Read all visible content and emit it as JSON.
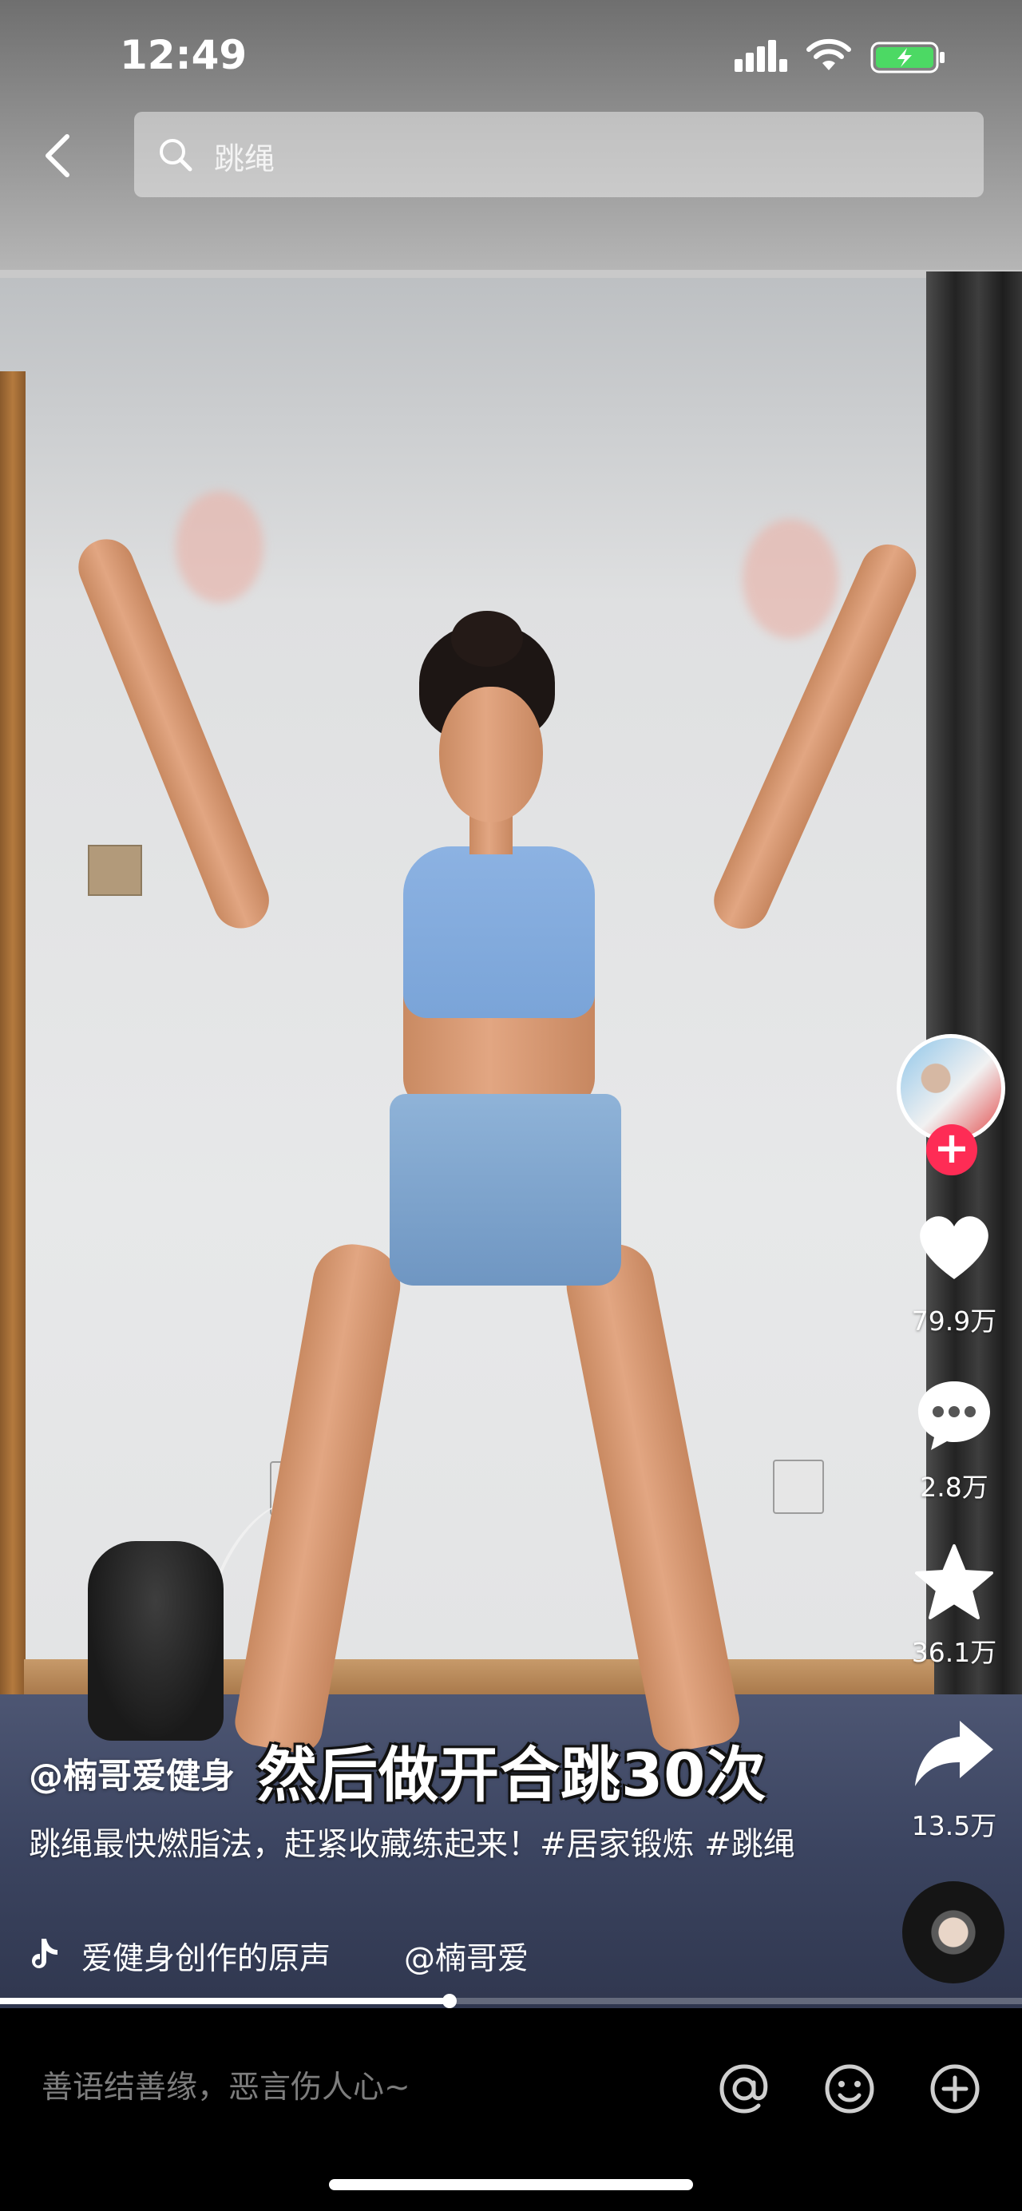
{
  "status_bar": {
    "time": "12:49"
  },
  "search": {
    "query": "跳绳"
  },
  "video": {
    "subtitle_overlay": "然后做开合跳30次",
    "author": "@楠哥爱健身",
    "description": "跳绳最快燃脂法，赶紧收藏练起来！#居家锻炼 #跳绳",
    "music_title": "爱健身创作的原声",
    "music_owner": "@楠哥爱",
    "progress": 0.44
  },
  "actions": {
    "likes": "79.9万",
    "comments": "2.8万",
    "favorites": "36.1万",
    "shares": "13.5万"
  },
  "comment_bar": {
    "placeholder": "善语结善缘，恶言伤人心~"
  },
  "icons": [
    "back-icon",
    "search-icon",
    "heart-icon",
    "comment-icon",
    "star-icon",
    "share-icon",
    "music-note-icon",
    "at-icon",
    "emoji-icon",
    "plus-icon"
  ]
}
